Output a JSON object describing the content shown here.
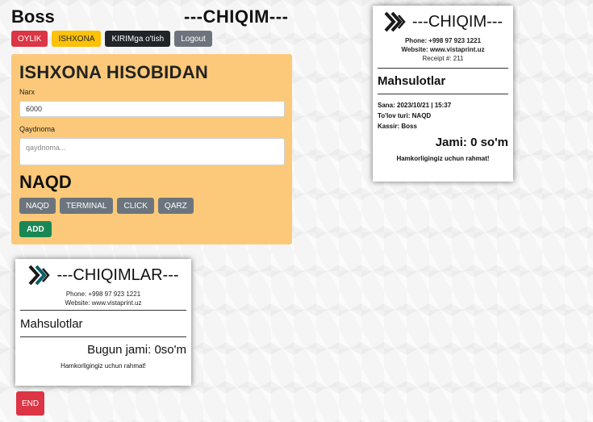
{
  "header": {
    "user": "Boss",
    "heading": "---CHIQIM---"
  },
  "nav": {
    "oylik": "OYLIK",
    "ishxona": "ISHXONA",
    "kirim": "KIRIMga o'tish",
    "logout": "Logout"
  },
  "form": {
    "title": "ISHXONA HISOBIDAN",
    "price_label": "Narx",
    "price_value": "6000",
    "note_label": "Qaydnoma",
    "note_placeholder": "qaydnoma...",
    "payment_title": "NAQD",
    "payment_options": [
      "NAQD",
      "TERMINAL",
      "CLICK",
      "QARZ"
    ],
    "add_label": "ADD"
  },
  "receipt_right": {
    "title": "---CHIQIM---",
    "phone": "Phone: +998 97 923 1221",
    "website": "Website: www.vistaprint.uz",
    "receipt_no": "Receipt #: 211",
    "section": "Mahsulotlar",
    "date": "Sana: 2023/10/21 | 15:37",
    "payment": "To'lov turi: NAQD",
    "cashier": "Kassir: Boss",
    "total": "Jami: 0 so'm",
    "thanks": "Hamkorligingiz uchun rahmat!"
  },
  "receipt_bottom": {
    "title": "---CHIQIMLAR---",
    "phone": "Phone: +998 97 923 1221",
    "website": "Website: www.vistaprint.uz",
    "section": "Mahsulotlar",
    "total": "Bugun jami: 0so'm",
    "thanks": "Hamkorligingiz uchun rahmat!"
  },
  "footer": {
    "end_label": "END"
  },
  "colors": {
    "form_bg": "#fcc97a",
    "danger": "#dc3545",
    "warning": "#ffc107",
    "dark": "#212529",
    "secondary": "#6c757d",
    "success": "#198754"
  },
  "icons": {
    "logo": "double-chevron-logo-icon"
  }
}
